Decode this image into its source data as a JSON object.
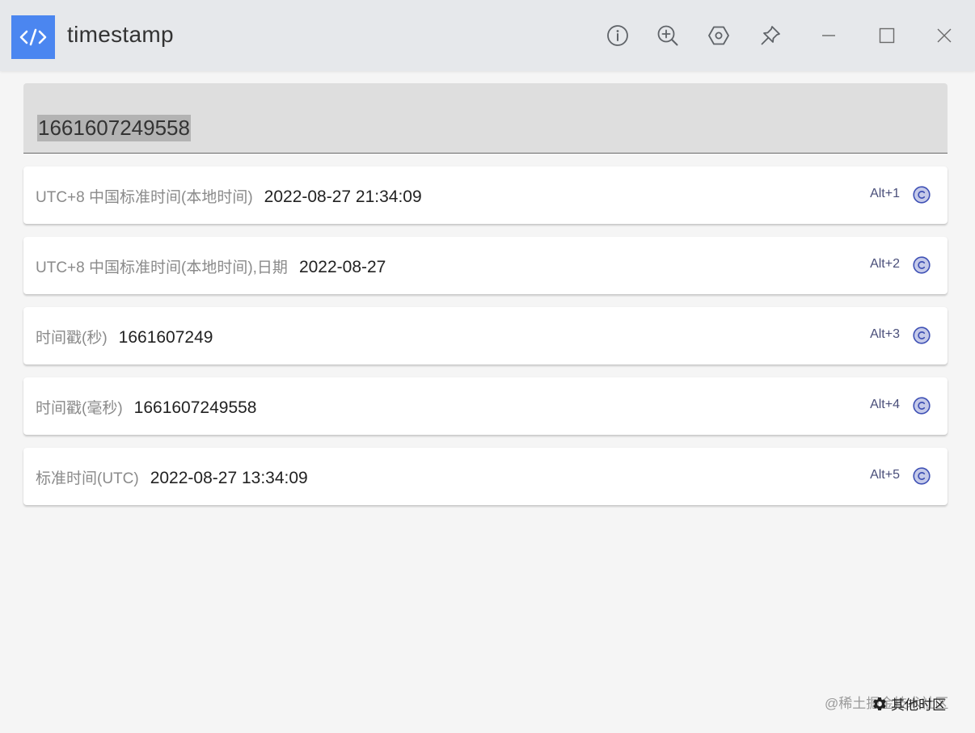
{
  "app": {
    "title": "timestamp"
  },
  "titlebar": {
    "icons": [
      "info-icon",
      "zoom-in-icon",
      "settings-hexagon-icon",
      "pin-icon",
      "minimize-icon",
      "maximize-icon",
      "close-icon"
    ]
  },
  "search": {
    "value": "1661607249558"
  },
  "results": [
    {
      "label": "UTC+8 中国标准时间(本地时间)",
      "value": "2022-08-27 21:34:09",
      "shortcut": "Alt+1"
    },
    {
      "label": "UTC+8 中国标准时间(本地时间),日期",
      "value": "2022-08-27",
      "shortcut": "Alt+2"
    },
    {
      "label": "时间戳(秒)",
      "value": "1661607249",
      "shortcut": "Alt+3"
    },
    {
      "label": "时间戳(毫秒)",
      "value": "1661607249558",
      "shortcut": "Alt+4"
    },
    {
      "label": "标准时间(UTC)",
      "value": "2022-08-27 13:34:09",
      "shortcut": "Alt+5"
    }
  ],
  "footer": {
    "label": "其他时区",
    "watermark": "@稀土掘金技术社区"
  },
  "colors": {
    "accent": "#4b86f0",
    "titlebar_bg": "#e6e8eb",
    "copy_icon": "#3f51b5"
  }
}
